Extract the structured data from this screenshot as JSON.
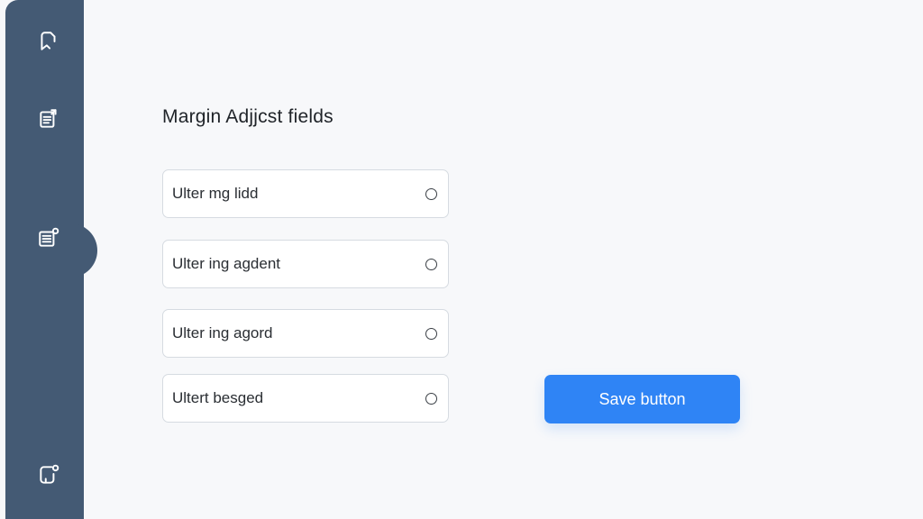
{
  "sidebar": {
    "items": [
      {
        "icon": "bookmark-arrow-icon"
      },
      {
        "icon": "document-edit-icon"
      },
      {
        "icon": "list-settings-icon"
      },
      {
        "icon": "square-badge-icon"
      }
    ]
  },
  "main": {
    "heading": "Margin Adjjcst fields",
    "fields": [
      {
        "label": "Ulter mg lidd"
      },
      {
        "label": "Ulter ing agdent"
      },
      {
        "label": "Ulter ing agord"
      },
      {
        "label": "Ultert besged"
      }
    ],
    "save_label": "Save button"
  },
  "colors": {
    "sidebar": "#445a74",
    "accent": "#2f84f5",
    "background": "#f7f8fa"
  }
}
